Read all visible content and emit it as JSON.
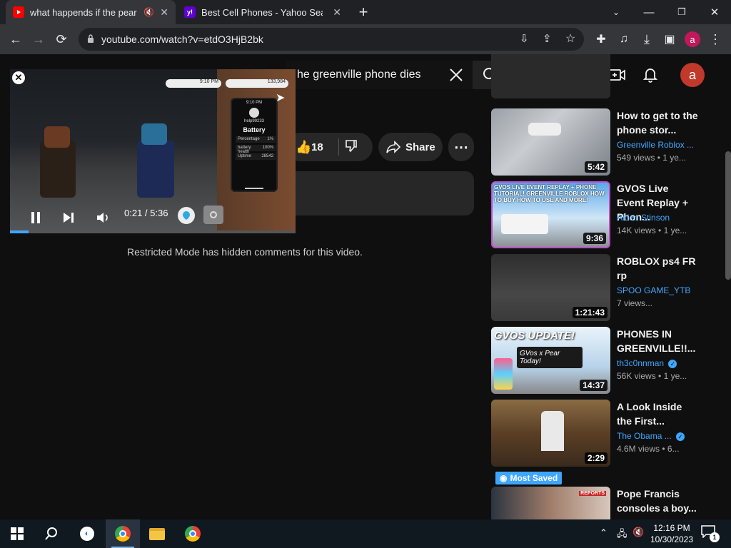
{
  "browser": {
    "tabs": [
      {
        "title": "what happends if the pear p",
        "favicon": "youtube-icon",
        "active": true
      },
      {
        "title": "Best Cell Phones - Yahoo Search",
        "favicon": "yahoo-icon",
        "active": false
      }
    ],
    "url": "youtube.com/watch?v=etdO3HjB2bk",
    "profile_initial": "a"
  },
  "youtube": {
    "search_query": "he greenville phone dies",
    "account_initial": "a",
    "like_count": "18",
    "share_label": "Share",
    "restricted_notice": "Restricted Mode has hidden comments for this video.",
    "accent_color": "#3ea6ff"
  },
  "miniplayer": {
    "time": "0:21 / 5:36",
    "progress": 0.065,
    "phone_screen": {
      "clock": "9:10 PM",
      "balance": "133,984",
      "username": "help99233",
      "title": "Battery",
      "rows": [
        {
          "label": "Percentage",
          "value": "1%"
        },
        {
          "label": "battery health",
          "value": "100%"
        },
        {
          "label": "Uptime",
          "value": "28542"
        }
      ]
    }
  },
  "related": [
    {
      "title": "How to get to the phone stor...",
      "channel": "Greenville Roblox ...",
      "views": "549 views",
      "age": "1 ye...",
      "duration": "5:42",
      "verified": false
    },
    {
      "title": "GVOS Live Event Replay + Phon...",
      "channel": "Aiden Stinson",
      "views": "14K views",
      "age": "1 ye...",
      "duration": "9:36",
      "verified": false,
      "thumb_text": "GVOS LIVE EVENT REPLAY + PHONE TUTORIAL! GREENVILLE ROBLOX HOW TO BUY HOW TO USE AND MORE!"
    },
    {
      "title": "ROBLOX ps4 FR rp",
      "channel": "SPOO GAME_YTB",
      "views": "7 views",
      "age": "",
      "duration": "1:21:43",
      "verified": false
    },
    {
      "title": "PHONES IN GREENVILLE!!...",
      "channel": "th3c0nnman",
      "views": "56K views",
      "age": "1 ye...",
      "duration": "14:37",
      "verified": true,
      "thumb_text": "GVOS UPDATE!",
      "thumb_subtext": "GVos x Pear Today!"
    },
    {
      "title": "A Look Inside the First...",
      "channel": "The Obama ...",
      "views": "4.6M views",
      "age": "6...",
      "duration": "2:29",
      "verified": true
    },
    {
      "title": "Pope Francis consoles a boy...",
      "channel": "",
      "views": "",
      "age": "",
      "duration": "",
      "verified": false,
      "badge": "Most Saved",
      "thumb_text": "REPORTS"
    }
  ],
  "taskbar": {
    "time": "12:16 PM",
    "date": "10/30/2023",
    "notification_count": "1"
  }
}
